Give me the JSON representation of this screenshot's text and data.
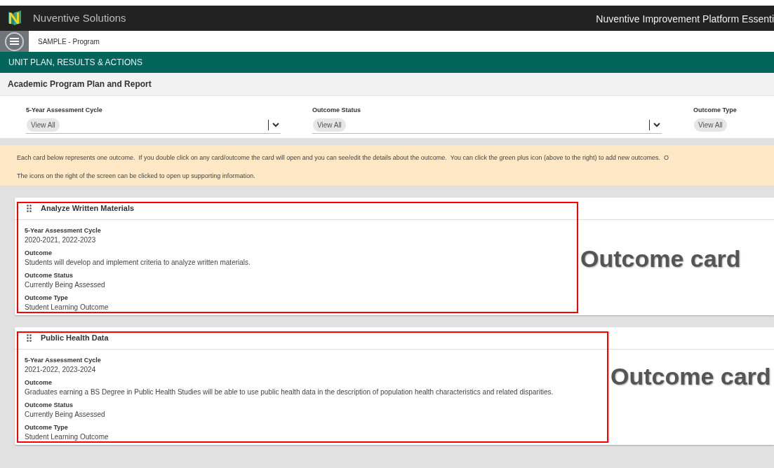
{
  "app": {
    "brand": "Nuventive Solutions",
    "product": "Nuventive Improvement Platform Essenti"
  },
  "context": "SAMPLE - Program",
  "section": "UNIT PLAN, RESULTS & ACTIONS",
  "page_title": "Academic Program Plan and Report",
  "filters": [
    {
      "label": "5-Year Assessment Cycle",
      "value": "View All"
    },
    {
      "label": "Outcome Status",
      "value": "View All"
    },
    {
      "label": "Outcome Type",
      "value": "View All"
    }
  ],
  "notice": [
    "Each card below represents one outcome.  If you double click on any card/outcome the card will open and you can see/edit the details about the outcome.  You can click the green plus icon (above to the right) to add new outcomes.  O",
    "The icons on the right of the screen can be clicked to open up supporting information."
  ],
  "cards": [
    {
      "title": "Analyze Written Materials",
      "fields": [
        {
          "label": "5-Year Assessment Cycle",
          "value": "2020-2021, 2022-2023"
        },
        {
          "label": "Outcome",
          "value": "Students will develop and implement criteria to analyze written materials."
        },
        {
          "label": "Outcome Status",
          "value": "Currently Being Assessed"
        },
        {
          "label": "Outcome Type",
          "value": "Student Learning Outcome"
        }
      ],
      "annotation": "Outcome card"
    },
    {
      "title": "Public Health Data",
      "fields": [
        {
          "label": "5-Year Assessment Cycle",
          "value": "2021-2022, 2023-2024"
        },
        {
          "label": "Outcome",
          "value": "Graduates earning a BS Degree in Public Health Studies will be able to use public health data in the description of population health characteristics and related disparities."
        },
        {
          "label": "Outcome Status",
          "value": "Currently Being Assessed"
        },
        {
          "label": "Outcome Type",
          "value": "Student Learning Outcome"
        }
      ],
      "annotation": "Outcome card"
    }
  ]
}
